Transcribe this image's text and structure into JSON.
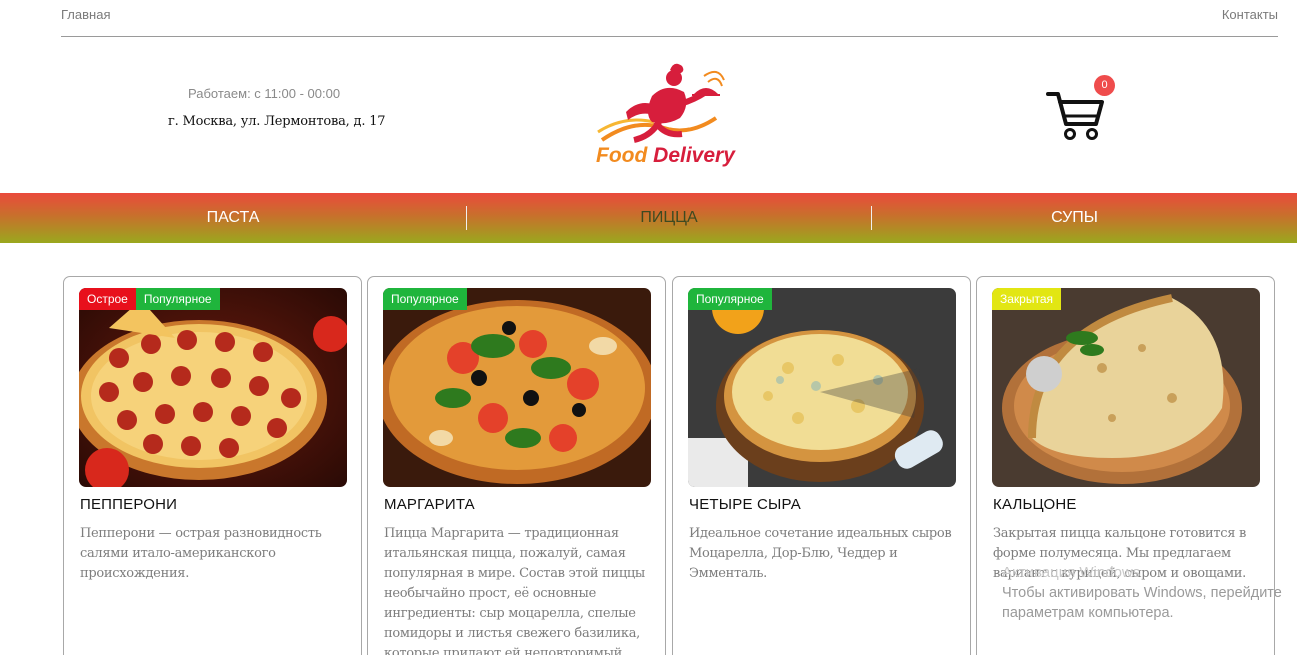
{
  "topbar": {
    "home": "Главная",
    "contacts": "Контакты"
  },
  "info": {
    "hours": "Работаем: с 11:00 - 00:00",
    "address": "г. Москва, ул. Лермонтова, д. 17"
  },
  "logo": {
    "word1": "Food",
    "word2": "Delivery"
  },
  "cart": {
    "count": "0"
  },
  "nav": {
    "items": [
      {
        "label": "ПАСТА"
      },
      {
        "label": "ПИЦЦА"
      },
      {
        "label": "СУПЫ"
      }
    ],
    "active": "ПИЦЦА"
  },
  "products": [
    {
      "title": "ПЕППЕРОНИ",
      "badges": [
        "Острое",
        "Популярное"
      ],
      "desc": "Пепперони — острая разновидность салями итало-американского происхождения."
    },
    {
      "title": "МАРГАРИТА",
      "badges": [
        "Популярное"
      ],
      "desc": "Пицца Маргарита — традиционная итальянская пицца, пожалуй, самая популярная в мире. Состав этой пиццы необычайно прост, её основные ингредиенты: сыр моцарелла, спелые помидоры и листья свежего базилика, которые придают ей неповторимый вкус и"
    },
    {
      "title": "ЧЕТЫРЕ СЫРА",
      "badges": [
        "Популярное"
      ],
      "desc": "Идеальное сочетание идеальных сыров Моцарелла, Дор-Блю, Чеддер и Эмменталь."
    },
    {
      "title": "КАЛЬЦОНЕ",
      "badges": [
        "Закрытая"
      ],
      "desc": "Закрытая пицца кальцоне готовится в форме полумесяца. Мы предлагаем вариант с курицей, сыром и овощами."
    }
  ],
  "watermark": {
    "line1": "Активация Windows",
    "line2": "Чтобы активировать Windows, перейдите",
    "line3": "параметрам компьютера."
  },
  "colors": {
    "nav_top": "#ea4a3c",
    "nav_bottom": "#9aa81e",
    "badge_hot": "#e8101c",
    "badge_popular": "#1fb53c",
    "badge_closed": "#e2e613",
    "cart_badge": "#ef4c4c"
  }
}
